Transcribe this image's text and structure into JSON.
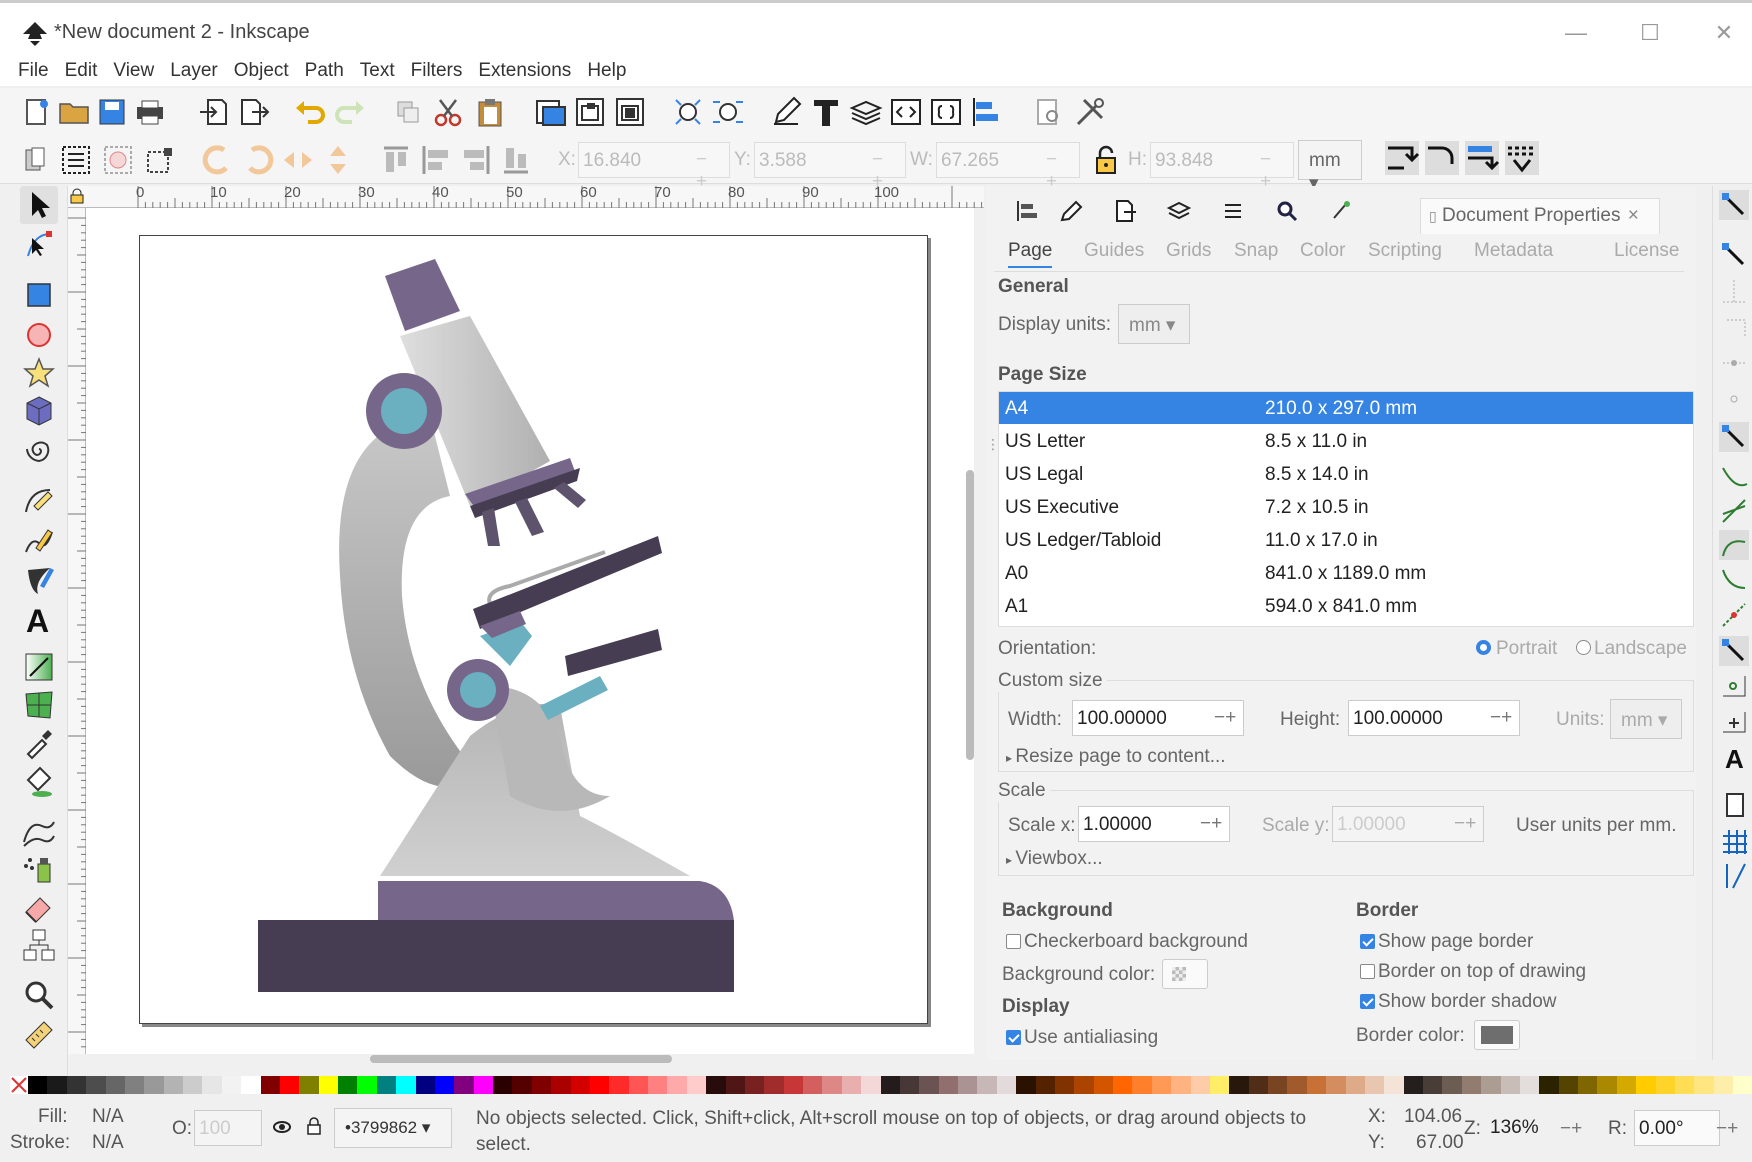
{
  "window": {
    "title": "*New document 2 - Inkscape",
    "minimize": "—",
    "maximize": "☐",
    "close": "✕"
  },
  "menu": [
    "File",
    "Edit",
    "View",
    "Layer",
    "Object",
    "Path",
    "Text",
    "Filters",
    "Extensions",
    "Help"
  ],
  "controls": {
    "x_label": "X:",
    "x_value": "16.840",
    "y_label": "Y:",
    "y_value": "3.588",
    "w_label": "W:",
    "w_value": "67.265",
    "h_label": "H:",
    "h_value": "93.848",
    "units": "mm",
    "pm": "−+"
  },
  "ruler": {
    "ticks": [
      "0",
      "10",
      "20",
      "30",
      "40",
      "50",
      "60",
      "70",
      "80",
      "90",
      "100"
    ]
  },
  "doc_properties": {
    "tab_title": "Document Properties",
    "subtabs": [
      "Page",
      "Guides",
      "Grids",
      "Snap",
      "Color",
      "Scripting",
      "Metadata",
      "License"
    ],
    "general": {
      "heading": "General",
      "display_units_label": "Display units:",
      "display_units_value": "mm"
    },
    "page_size": {
      "heading": "Page Size",
      "rows": [
        {
          "name": "A4",
          "size": "210.0 x 297.0 mm"
        },
        {
          "name": "US Letter",
          "size": "8.5 x 11.0 in"
        },
        {
          "name": "US Legal",
          "size": "8.5 x 14.0 in"
        },
        {
          "name": "US Executive",
          "size": "7.2 x 10.5 in"
        },
        {
          "name": "US Ledger/Tabloid",
          "size": "11.0 x 17.0 in"
        },
        {
          "name": "A0",
          "size": "841.0 x 1189.0 mm"
        },
        {
          "name": "A1",
          "size": "594.0 x 841.0 mm"
        }
      ]
    },
    "orientation": {
      "label": "Orientation:",
      "portrait": "Portrait",
      "landscape": "Landscape"
    },
    "custom_size": {
      "label": "Custom size",
      "width_label": "Width:",
      "width_value": "100.00000",
      "height_label": "Height:",
      "height_value": "100.00000",
      "units_label": "Units:",
      "units_value": "mm",
      "resize": "Resize page to content..."
    },
    "scale": {
      "label": "Scale",
      "scale_x_label": "Scale x:",
      "scale_x_value": "1.00000",
      "scale_y_label": "Scale y:",
      "scale_y_value": "1.00000",
      "user_units": "User units per mm.",
      "viewbox": "Viewbox..."
    },
    "background": {
      "heading": "Background",
      "checkerboard": "Checkerboard background",
      "color_label": "Background color:"
    },
    "display": {
      "heading": "Display",
      "antialiasing": "Use antialiasing"
    },
    "border": {
      "heading": "Border",
      "show_border": "Show page border",
      "on_top": "Border on top of drawing",
      "shadow": "Show border shadow",
      "color_label": "Border color:"
    }
  },
  "status": {
    "fill_label": "Fill:",
    "fill_value": "N/A",
    "stroke_label": "Stroke:",
    "stroke_value": "N/A",
    "opacity_label": "O:",
    "opacity_value": "100",
    "layer": "•3799862",
    "message": "No objects selected. Click, Shift+click, Alt+scroll mouse on top of objects, or drag around objects to select.",
    "x_label": "X:",
    "x_value": "104.06",
    "y_label": "Y:",
    "y_value": "67.00",
    "z_label": "Z:",
    "zoom": "136%",
    "r_label": "R:",
    "rotation": "0.00°",
    "pm": "−+"
  },
  "colors": {
    "selection": "#3584e4",
    "microscope_purple": "#76678a",
    "microscope_dark": "#473d52",
    "microscope_teal": "#6ab0c0",
    "microscope_gray": "#bdbdbd"
  }
}
